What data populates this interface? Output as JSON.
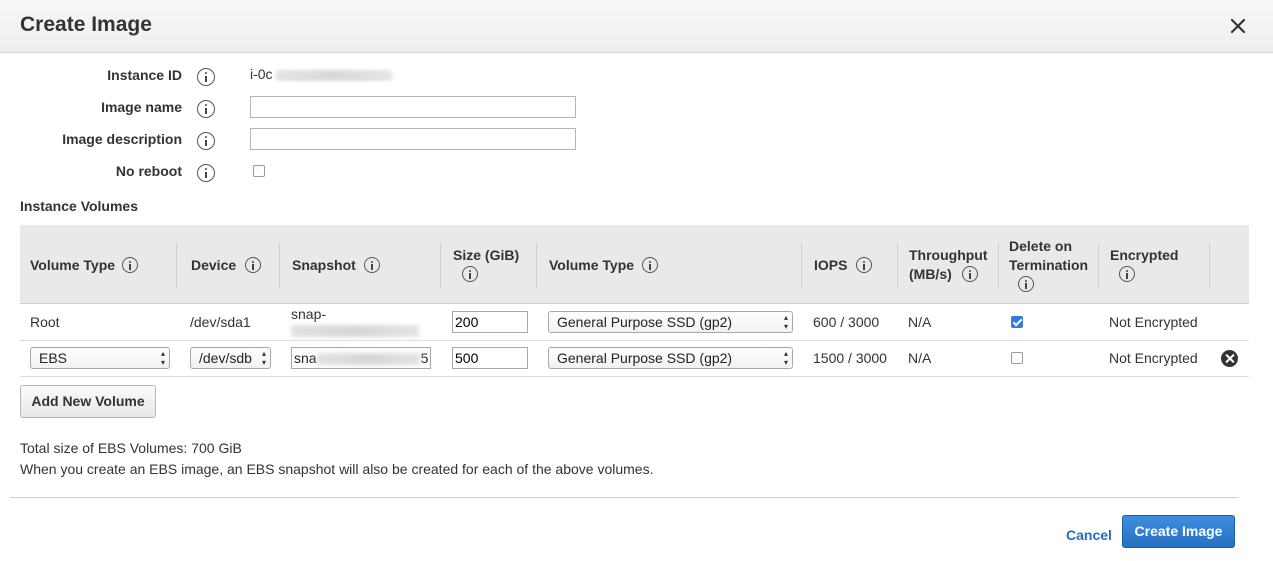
{
  "dialog": {
    "title": "Create Image",
    "close_icon": "close-icon"
  },
  "form": {
    "instance_id_label": "Instance ID",
    "instance_id_value": "i-0c",
    "image_name_label": "Image name",
    "image_name_value": "",
    "image_description_label": "Image description",
    "image_description_value": "",
    "no_reboot_label": "No reboot",
    "no_reboot_checked": false
  },
  "volumes": {
    "section_title": "Instance Volumes",
    "headers": {
      "volume_type": "Volume Type",
      "device": "Device",
      "snapshot": "Snapshot",
      "size_line1": "Size (GiB)",
      "ebs_volume_type": "Volume Type",
      "iops": "IOPS",
      "throughput_line1": "Throughput",
      "throughput_line2": "(MB/s)",
      "delete_line1": "Delete on",
      "delete_line2": "Termination",
      "encrypted": "Encrypted"
    },
    "rows": [
      {
        "volume_type": "Root",
        "device": "/dev/sda1",
        "snapshot": "snap-",
        "size": "200",
        "ebs_volume_type": "General Purpose SSD (gp2)",
        "iops": "600 / 3000",
        "throughput": "N/A",
        "delete_on_termination": true,
        "encrypted": "Not Encrypted"
      },
      {
        "volume_type": "EBS",
        "device": "/dev/sdb",
        "snapshot": "sna",
        "snapshot_suffix": "5",
        "size": "500",
        "ebs_volume_type": "General Purpose SSD (gp2)",
        "iops": "1500 / 3000",
        "throughput": "N/A",
        "delete_on_termination": false,
        "encrypted": "Not Encrypted"
      }
    ],
    "add_button": "Add New Volume"
  },
  "footer": {
    "total_size": "Total size of EBS Volumes: 700 GiB",
    "note": "When you create an EBS image, an EBS snapshot will also be created for each of the above volumes.",
    "cancel_label": "Cancel",
    "create_label": "Create Image"
  },
  "colors": {
    "primary": "#2670c4",
    "link": "#1f6fc7",
    "checkbox_checked": "#2f7be2"
  }
}
